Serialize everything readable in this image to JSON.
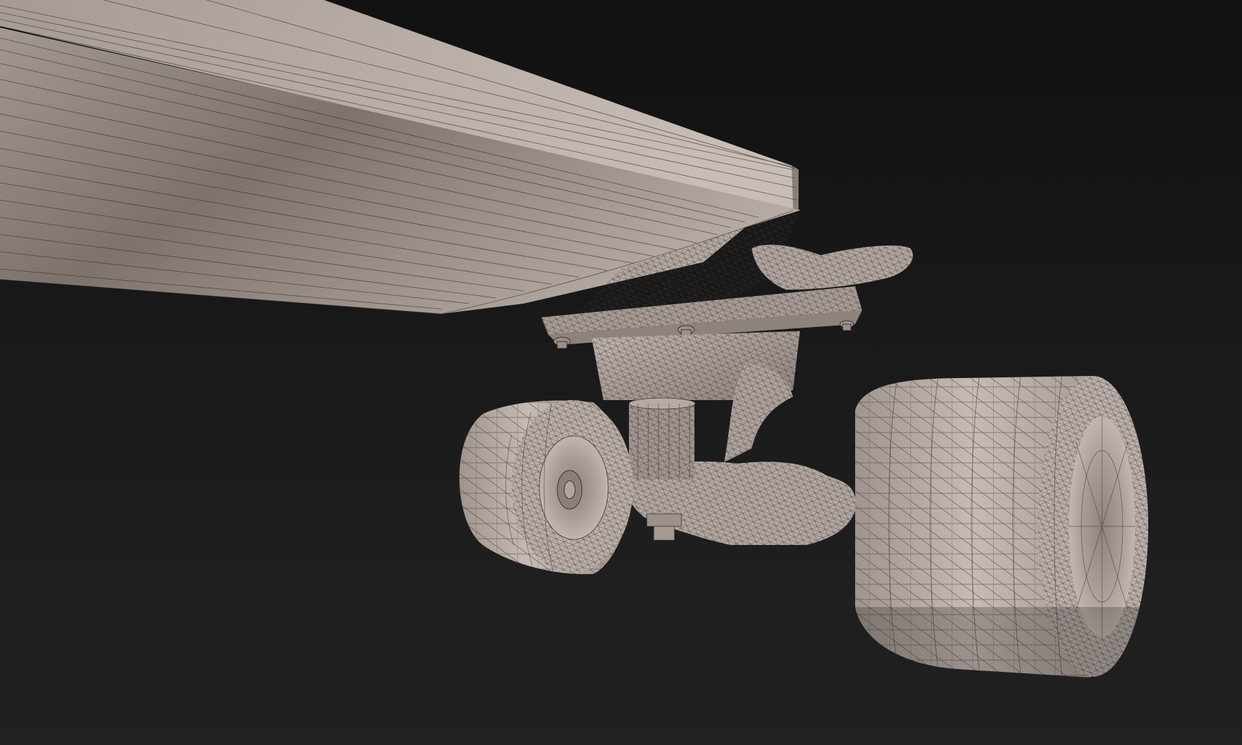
{
  "viewport": {
    "background_top": "#111111",
    "background_bottom": "#232323"
  },
  "model": {
    "shading": "wireframe-on-shaded",
    "surface_color": "#b9ada7",
    "surface_shadow_color": "#6f6660",
    "wire_color": "#3a3431",
    "parts": [
      "deck",
      "baseplate",
      "kingpin-bushing",
      "hanger",
      "axle",
      "near-wheel",
      "far-wheel",
      "bolts"
    ]
  }
}
